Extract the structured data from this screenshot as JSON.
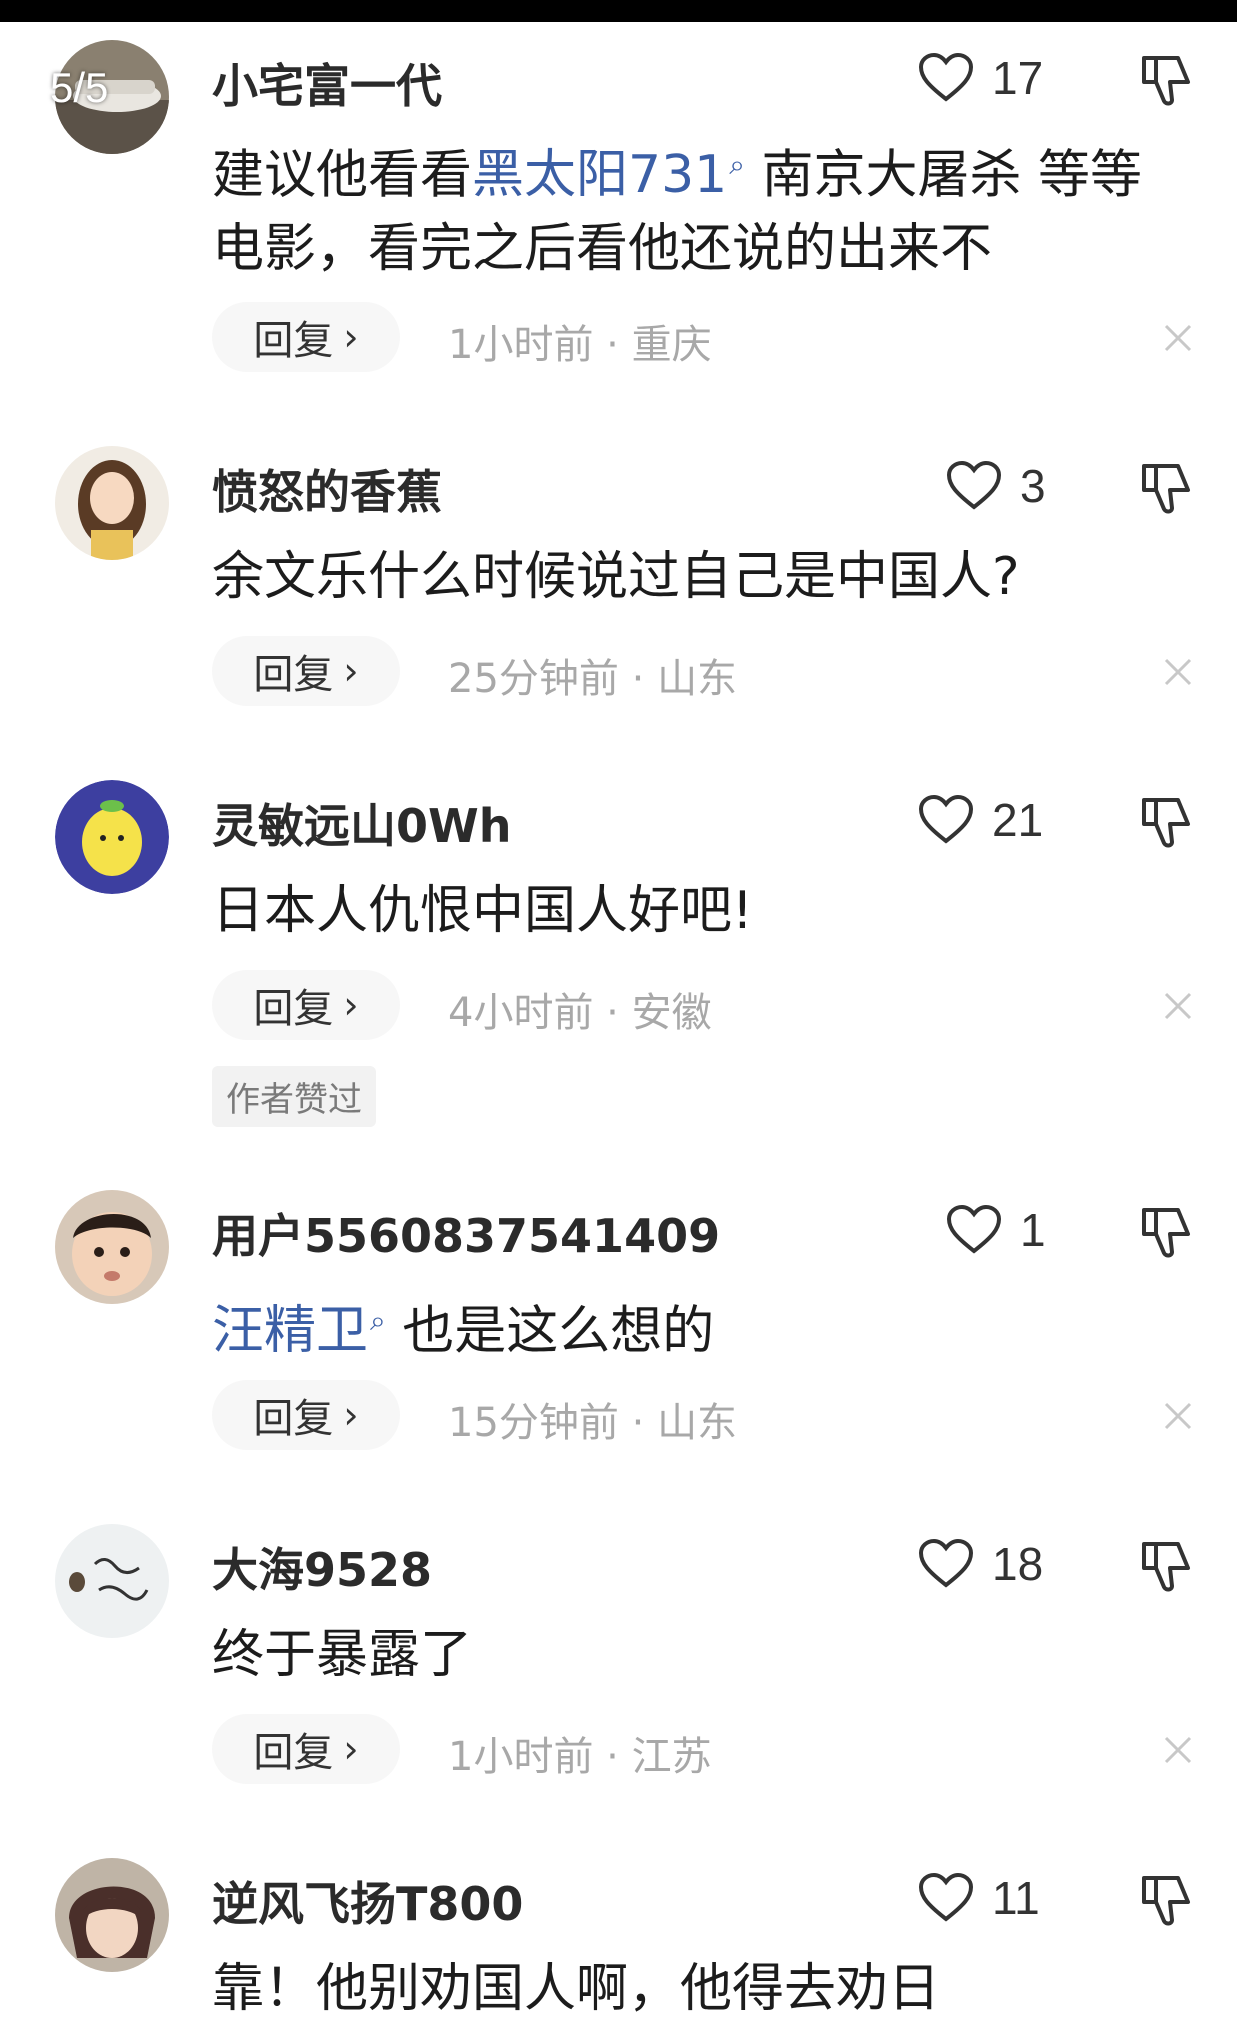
{
  "page_indicator": "5/5",
  "comments": [
    {
      "username": "小宅富一代",
      "likes": "17",
      "body_plain_before": "建议他看看",
      "topic": "黑太阳731",
      "body_plain_after": " 南京大屠杀 等等电影，看完之后看他还说的出来不",
      "reply_label": "回复",
      "time": "1小时前",
      "location": "重庆",
      "avatar_icon": "car-photo-avatar"
    },
    {
      "username": "愤怒的香蕉",
      "likes": "3",
      "body": "余文乐什么时候说过自己是中国人?",
      "reply_label": "回复",
      "time": "25分钟前",
      "location": "山东",
      "avatar_icon": "girl-illustration-avatar"
    },
    {
      "username": "灵敏远山0Wh",
      "likes": "21",
      "body": "日本人仇恨中国人好吧!",
      "reply_label": "回复",
      "time": "4小时前",
      "location": "安徽",
      "author_liked_badge": "作者赞过",
      "avatar_icon": "lemon-cartoon-avatar"
    },
    {
      "username": "用户5560837541409",
      "likes": "1",
      "topic": "汪精卫",
      "body_plain_after": " 也是这么想的",
      "reply_label": "回复",
      "time": "15分钟前",
      "location": "山东",
      "avatar_icon": "baby-photo-avatar"
    },
    {
      "username": "大海9528",
      "likes": "18",
      "body": "终于暴露了",
      "reply_label": "回复",
      "time": "1小时前",
      "location": "江苏",
      "avatar_icon": "handwriting-avatar"
    },
    {
      "username": "逆风飞扬T800",
      "likes": "11",
      "body": "靠！他别劝国人啊，他得去劝日",
      "avatar_icon": "anime-character-avatar"
    }
  ],
  "colors": {
    "topic_link": "#3b5fa6",
    "meta_text": "#a8a8a8",
    "background": "#ffffff"
  }
}
